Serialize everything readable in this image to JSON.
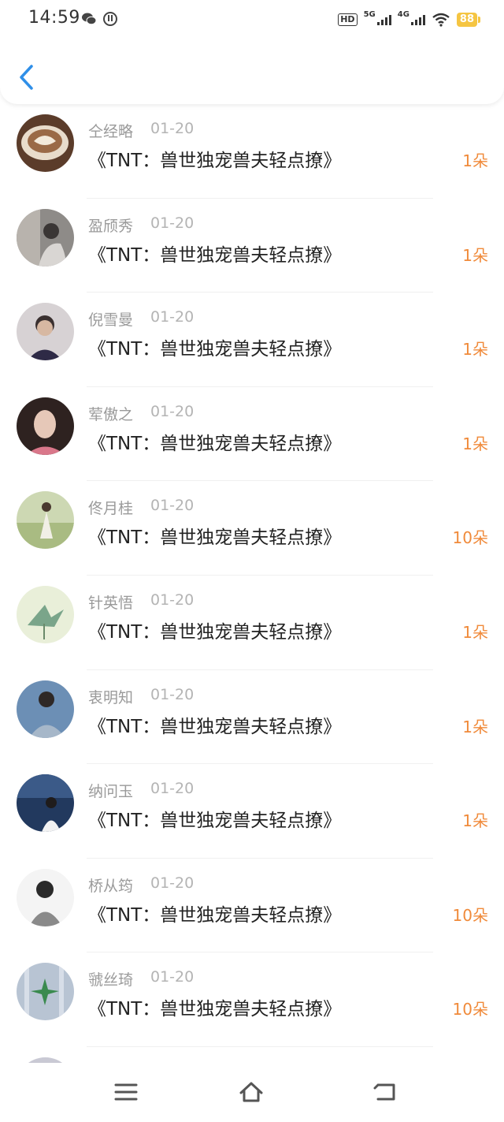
{
  "status_bar": {
    "time": "14:59",
    "hd_label": "HD",
    "net1_label": "5G",
    "net2_label": "4G",
    "battery": "88",
    "icons": [
      "wechat-icon",
      "clock-icon",
      "hd-icon",
      "signal-icon",
      "wifi-icon",
      "battery-icon"
    ]
  },
  "header": {
    "back_icon": "chevron-left-icon",
    "accent_color": "#2f8fe8"
  },
  "list": {
    "items": [
      {
        "name": "仝经略",
        "date": "01-20",
        "title": "《TNT：兽世独宠兽夫轻点撩》",
        "amount": "1朵",
        "avatar_color": "#6b4a35"
      },
      {
        "name": "盈颀秀",
        "date": "01-20",
        "title": "《TNT：兽世独宠兽夫轻点撩》",
        "amount": "1朵",
        "avatar_color": "#7c7a78"
      },
      {
        "name": "倪雪曼",
        "date": "01-20",
        "title": "《TNT：兽世独宠兽夫轻点撩》",
        "amount": "1朵",
        "avatar_color": "#4a4e63"
      },
      {
        "name": "荤傲之",
        "date": "01-20",
        "title": "《TNT：兽世独宠兽夫轻点撩》",
        "amount": "1朵",
        "avatar_color": "#3a2e2c"
      },
      {
        "name": "佟月桂",
        "date": "01-20",
        "title": "《TNT：兽世独宠兽夫轻点撩》",
        "amount": "10朵",
        "avatar_color": "#b9c79a"
      },
      {
        "name": "针英悟",
        "date": "01-20",
        "title": "《TNT：兽世独宠兽夫轻点撩》",
        "amount": "1朵",
        "avatar_color": "#a8c79a"
      },
      {
        "name": "衷明知",
        "date": "01-20",
        "title": "《TNT：兽世独宠兽夫轻点撩》",
        "amount": "1朵",
        "avatar_color": "#5a7fa8"
      },
      {
        "name": "纳问玉",
        "date": "01-20",
        "title": "《TNT：兽世独宠兽夫轻点撩》",
        "amount": "1朵",
        "avatar_color": "#2c4a78"
      },
      {
        "name": "桥从筠",
        "date": "01-20",
        "title": "《TNT：兽世独宠兽夫轻点撩》",
        "amount": "10朵",
        "avatar_color": "#8a8a8a"
      },
      {
        "name": "虢丝琦",
        "date": "01-20",
        "title": "《TNT：兽世独宠兽夫轻点撩》",
        "amount": "10朵",
        "avatar_color": "#9db0c4"
      }
    ],
    "amount_color": "#f08a3a"
  },
  "nav_bar": {
    "icons": [
      "menu-icon",
      "home-icon",
      "back-icon"
    ]
  }
}
